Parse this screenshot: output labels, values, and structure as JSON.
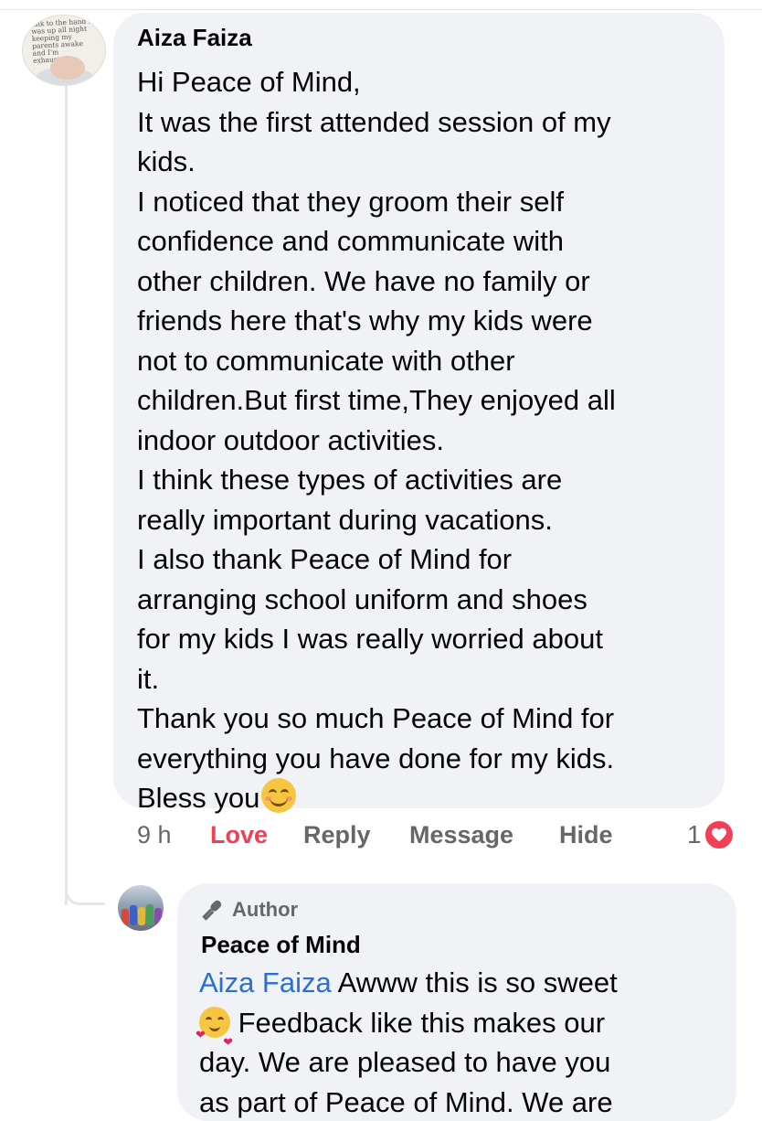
{
  "comment": {
    "author": "Aiza Faiza",
    "avatar_caption": "talk to the hand\nI was up all night keeping my parents awake and I'm exhausted...",
    "lines": [
      "Hi Peace of Mind,",
      "It was the first attended session of my",
      "kids.",
      "I noticed that they groom their self",
      "confidence and communicate with",
      "other children. We have no family or",
      "friends here that's why my kids were",
      "not to communicate with other",
      "children.But first time,They enjoyed all",
      "indoor outdoor activities.",
      "I think these types of activities are",
      "really important during vacations.",
      "I also thank Peace of Mind for",
      "arranging school uniform and shoes",
      "for my kids I was really worried about",
      "it.",
      "Thank you so much Peace of Mind for",
      "everything you have done for my kids."
    ],
    "last_line": "Bless you",
    "emoji": "smiling-face-emoji"
  },
  "actions": {
    "time": "9 h",
    "love": "Love",
    "reply": "Reply",
    "message": "Message",
    "hide": "Hide",
    "reaction_count": "1",
    "reaction_icon": "heart-icon"
  },
  "reply": {
    "badge": "Author",
    "badge_icon": "microphone-icon",
    "author": "Peace of Mind",
    "mention": "Aiza Faiza",
    "line1_rest": " Awww this is so sweet",
    "line2": " Feedback like this makes our",
    "line3": "day. We are pleased to have you",
    "line4": "as part of Peace of Mind. We are",
    "emoji": "smiling-face-with-hearts-emoji"
  },
  "colors": {
    "bubble_bg": "#f0f2f5",
    "love_red": "#f33e58",
    "mention_blue": "#2a6fd6",
    "meta_gray": "#65676b"
  }
}
